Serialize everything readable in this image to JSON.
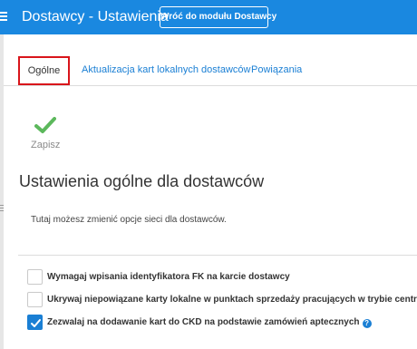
{
  "header": {
    "title": "Dostawcy - Ustawienia",
    "back_button_label": "Wróć do modułu Dostawcy",
    "background_color": "#1a88e0"
  },
  "tabs": [
    {
      "label": "Ogólne",
      "active": true
    },
    {
      "label": "Aktualizacja kart lokalnych dostawców",
      "active": false
    },
    {
      "label": "Powiązania",
      "active": false
    }
  ],
  "toolbar": {
    "save_label": "Zapisz",
    "save_icon": "checkmark-icon",
    "save_icon_color": "#5cb85c"
  },
  "section": {
    "title": "Ustawienia ogólne dla dostawców",
    "description": "Tutaj możesz zmienić opcje sieci dla dostawców."
  },
  "options": [
    {
      "label": "Wymagaj wpisania identyfikatora FK na karcie dostawcy",
      "checked": false,
      "help": false
    },
    {
      "label": "Ukrywaj niepowiązane karty lokalne w punktach sprzedaży pracujących w trybie centralnym",
      "checked": false,
      "help": false
    },
    {
      "label": "Zezwalaj na dodawanie kart do CKD na podstawie zamówień aptecznych",
      "checked": true,
      "help": true,
      "help_icon_text": "?"
    }
  ],
  "colors": {
    "accent": "#1a7fd4",
    "active_tab_highlight": "#d9151b"
  }
}
